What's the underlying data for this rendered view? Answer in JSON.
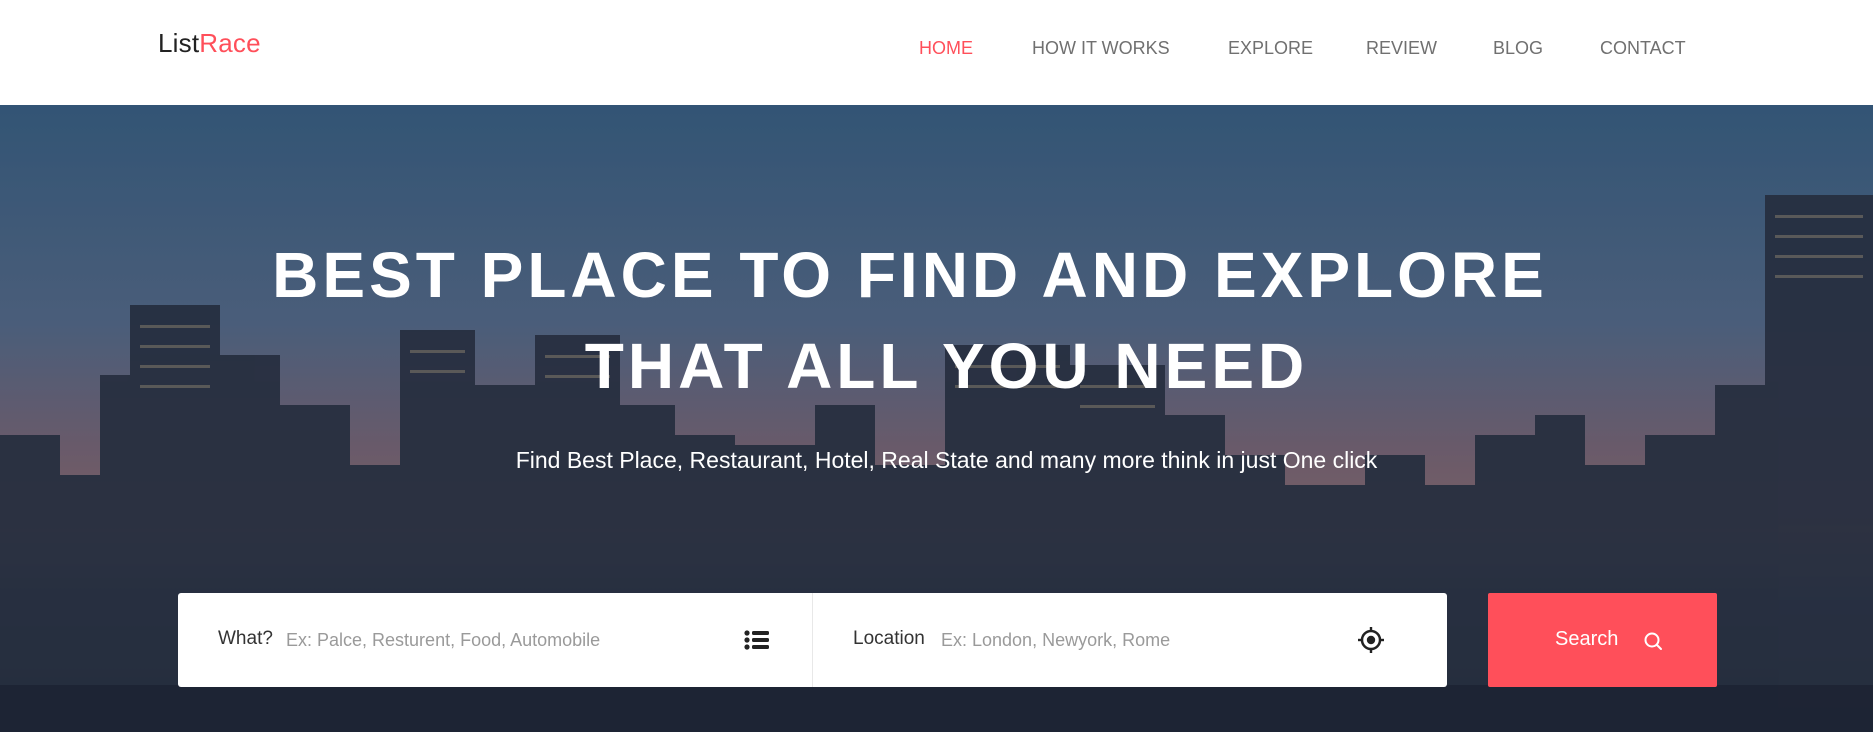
{
  "header": {
    "logo_part1": "List",
    "logo_part2": "Race",
    "nav": [
      {
        "label": "HOME",
        "active": true
      },
      {
        "label": "HOW IT WORKS",
        "active": false
      },
      {
        "label": "EXPLORE",
        "active": false
      },
      {
        "label": "REVIEW",
        "active": false
      },
      {
        "label": "BLOG",
        "active": false
      },
      {
        "label": "CONTACT",
        "active": false
      }
    ]
  },
  "hero": {
    "title_line1": "BEST PLACE TO FIND AND EXPLORE",
    "title_line2": "THAT ALL YOU NEED",
    "subtitle": "Find Best Place, Restaurant, Hotel, Real State and many more think in just One click"
  },
  "search": {
    "what_label": "What?",
    "what_placeholder": "Ex: Palce, Resturent, Food, Automobile",
    "what_icon": "list-icon",
    "location_label": "Location",
    "location_placeholder": "Ex: London, Newyork, Rome",
    "location_icon": "crosshair-icon",
    "button_label": "Search",
    "button_icon": "search-icon"
  },
  "colors": {
    "accent": "#ff4f5a",
    "nav_text": "#707070",
    "white": "#ffffff"
  }
}
